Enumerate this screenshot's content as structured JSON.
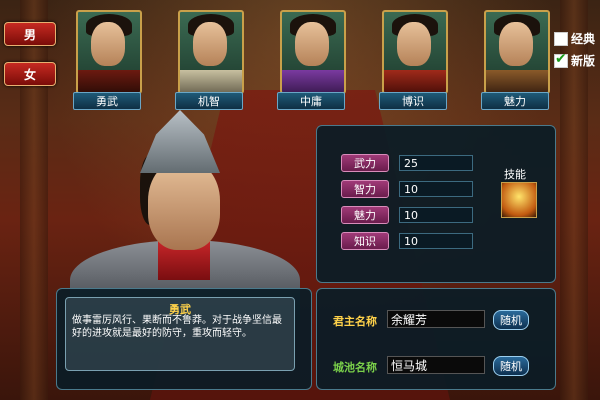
{
  "gender": {
    "male": "男",
    "female": "女"
  },
  "personalities": [
    {
      "label": "勇武"
    },
    {
      "label": "机智"
    },
    {
      "label": "中庸"
    },
    {
      "label": "博识"
    },
    {
      "label": "魅力"
    }
  ],
  "options": {
    "classic": "经典",
    "new": "新版",
    "classic_checked": false,
    "new_checked": true
  },
  "stats": [
    {
      "label": "武力",
      "value": "25"
    },
    {
      "label": "智力",
      "value": "10"
    },
    {
      "label": "魅力",
      "value": "10"
    },
    {
      "label": "知识",
      "value": "10"
    }
  ],
  "skill": {
    "label": "技能",
    "icon": "skill-icon"
  },
  "description": {
    "title": "勇武",
    "text": "做事雷厉风行、果断而不鲁莽。对于战争坚信最好的进攻就是最好的防守，重攻而轻守。"
  },
  "lord_name": {
    "label": "君主名称",
    "value": "余耀芳",
    "random": "随机"
  },
  "city_name": {
    "label": "城池名称",
    "value": "恒马城",
    "random": "随机"
  },
  "colors": {
    "lord_label": "#ffd24a",
    "city_label": "#7ad04a"
  }
}
